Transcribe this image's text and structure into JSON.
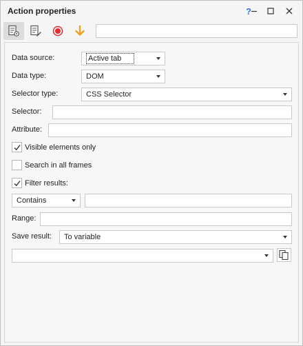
{
  "window": {
    "title": "Action properties",
    "help_label": "?"
  },
  "toolbar": {
    "tools": [
      {
        "icon": "action-settings-icon"
      },
      {
        "icon": "edit-document-icon"
      },
      {
        "icon": "record-icon",
        "color": "#e03030"
      },
      {
        "icon": "arrow-down-icon",
        "color": "#f0a020"
      }
    ],
    "search_value": ""
  },
  "form": {
    "data_source": {
      "label": "Data source:",
      "value": "Active tab"
    },
    "data_type": {
      "label": "Data type:",
      "value": "DOM"
    },
    "selector_type": {
      "label": "Selector type:",
      "value": "CSS Selector"
    },
    "selector": {
      "label": "Selector:",
      "value": ""
    },
    "attribute": {
      "label": "Attribute:",
      "value": ""
    },
    "visible_only": {
      "label": "Visible elements only",
      "checked": true
    },
    "search_frames": {
      "label": "Search in all frames",
      "checked": false
    },
    "filter_results": {
      "label": "Filter results:",
      "checked": true
    },
    "filter_mode": {
      "value": "Contains"
    },
    "filter_text": {
      "value": ""
    },
    "range": {
      "label": "Range:",
      "value": ""
    },
    "save_result": {
      "label": "Save result:",
      "value": "To variable"
    },
    "variable": {
      "value": ""
    }
  }
}
